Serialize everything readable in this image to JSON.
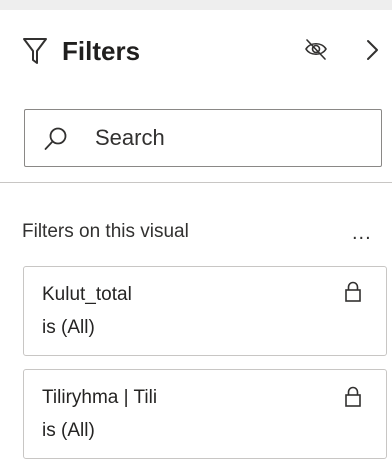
{
  "header": {
    "title": "Filters",
    "icons": [
      "filter-icon",
      "eye-hidden-icon",
      "chevron-right-icon"
    ]
  },
  "search": {
    "value": "",
    "placeholder": "Search"
  },
  "section": {
    "label": "Filters on this visual",
    "more": "..."
  },
  "filters": [
    {
      "name": "Kulut_total",
      "value": "is (All)",
      "locked": true
    },
    {
      "name": "Tiliryhma | Tili",
      "value": "is (All)",
      "locked": true
    }
  ],
  "colors": {
    "text": "#252423",
    "border": "#c8c6c4",
    "input_border": "#8a8886",
    "icon": "#323130"
  }
}
